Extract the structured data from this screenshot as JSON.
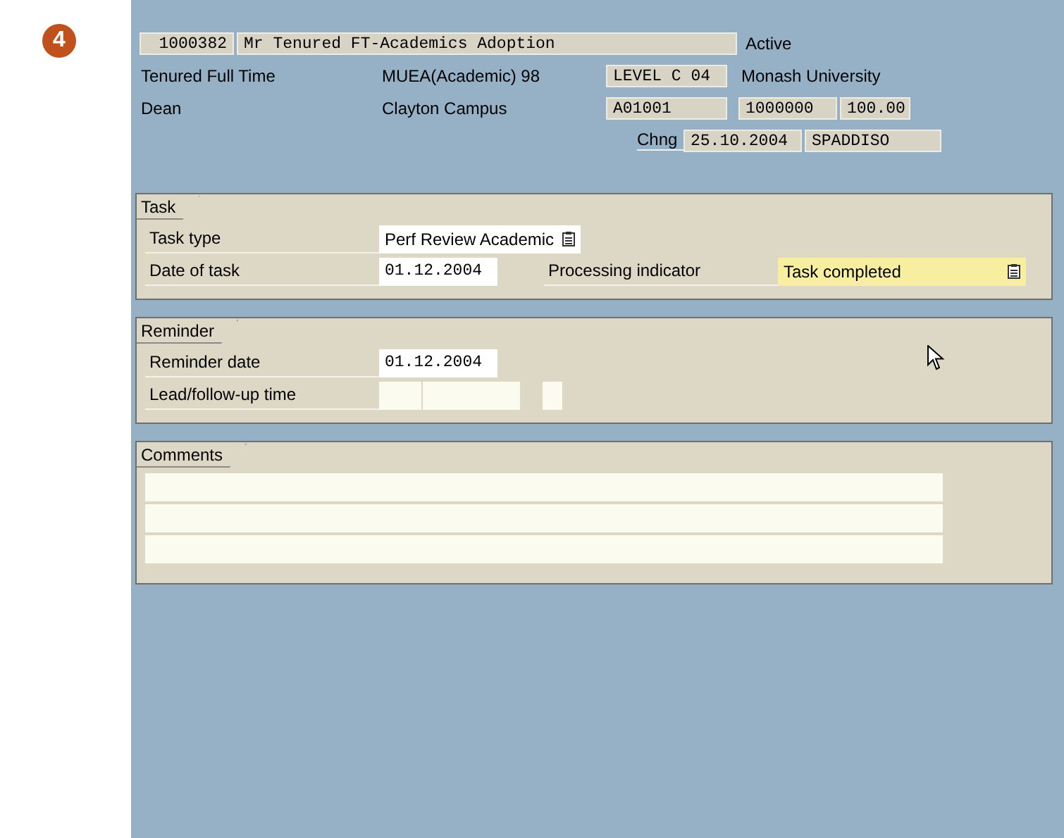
{
  "step_badge": "4",
  "header": {
    "personnel_number": "1000382",
    "name": "Mr Tenured FT-Academics Adoption",
    "status": "Active",
    "employment": "Tenured Full Time",
    "award": "MUEA(Academic) 98",
    "level": "LEVEL C 04",
    "organisation": "Monash University",
    "position": "Dean",
    "location": "Clayton Campus",
    "cost_centre": "A01001",
    "number": "1000000",
    "percentage": "100.00",
    "change_label": "Chng",
    "change_date": "25.10.2004",
    "changed_by": "SPADDISO"
  },
  "task": {
    "title": "Task",
    "task_type_label": "Task type",
    "task_type": "Perf Review Academic",
    "date_label": "Date of task",
    "date": "01.12.2004",
    "processing_label": "Processing indicator",
    "processing": {
      "value": "Task completed",
      "focused": true
    }
  },
  "reminder": {
    "title": "Reminder",
    "date_label": "Reminder date",
    "date": "01.12.2004",
    "lead_label": "Lead/follow-up time"
  },
  "comments": {
    "title": "Comments"
  }
}
